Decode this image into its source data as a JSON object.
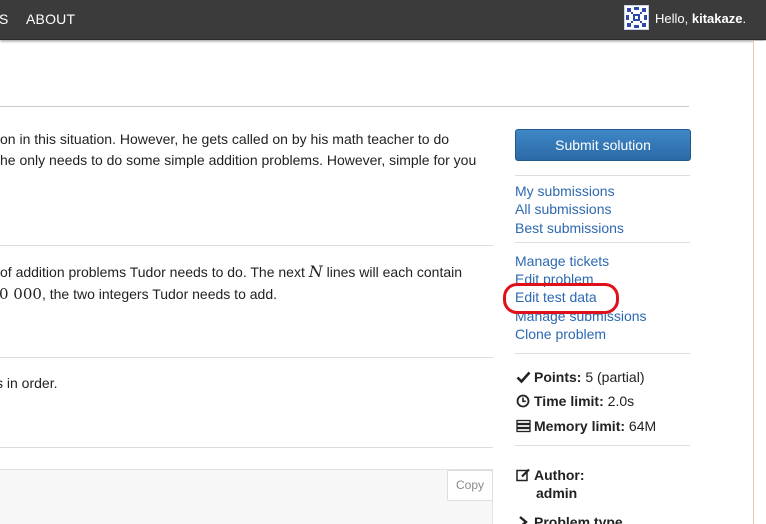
{
  "nav": {
    "items": [
      {
        "label": "S"
      },
      {
        "label": "ABOUT"
      }
    ],
    "greeting_prefix": "Hello,",
    "username": "kitakaze",
    "greeting_suffix": "."
  },
  "problem": {
    "paragraph1": [
      "on in this situation. However, he gets called on by his math teacher to do",
      "he only needs to do some simple addition problems. However, simple for you"
    ],
    "input": {
      "line1_prefix": "of addition problems Tudor needs to do. The next",
      "line1_var": "N",
      "line1_suffix": "lines will each contain",
      "line2_number": "0 000",
      "line2_suffix": ", the two integers Tudor needs to add."
    },
    "output": {
      "line1_partial_char": "s",
      "line1": "in order."
    },
    "copy_label": "Copy"
  },
  "sidebar": {
    "submit_label": "Submit solution",
    "links_group1": [
      "My submissions",
      "All submissions",
      "Best submissions"
    ],
    "links_group2": [
      "Manage tickets",
      "Edit problem",
      "Edit test data",
      "Manage submissions",
      "Clone problem"
    ],
    "info": {
      "points_label": "Points:",
      "points_value": "5 (partial)",
      "time_label": "Time limit:",
      "time_value": "2.0s",
      "memory_label": "Memory limit:",
      "memory_value": "64M",
      "author_label": "Author:",
      "author_value": "admin",
      "problem_type_label": "Problem type"
    }
  },
  "colors": {
    "nav_background": "#3b3b3b",
    "link": "#2d69b0",
    "submit_button": "#3478b8",
    "highlight": "#e0101a"
  }
}
